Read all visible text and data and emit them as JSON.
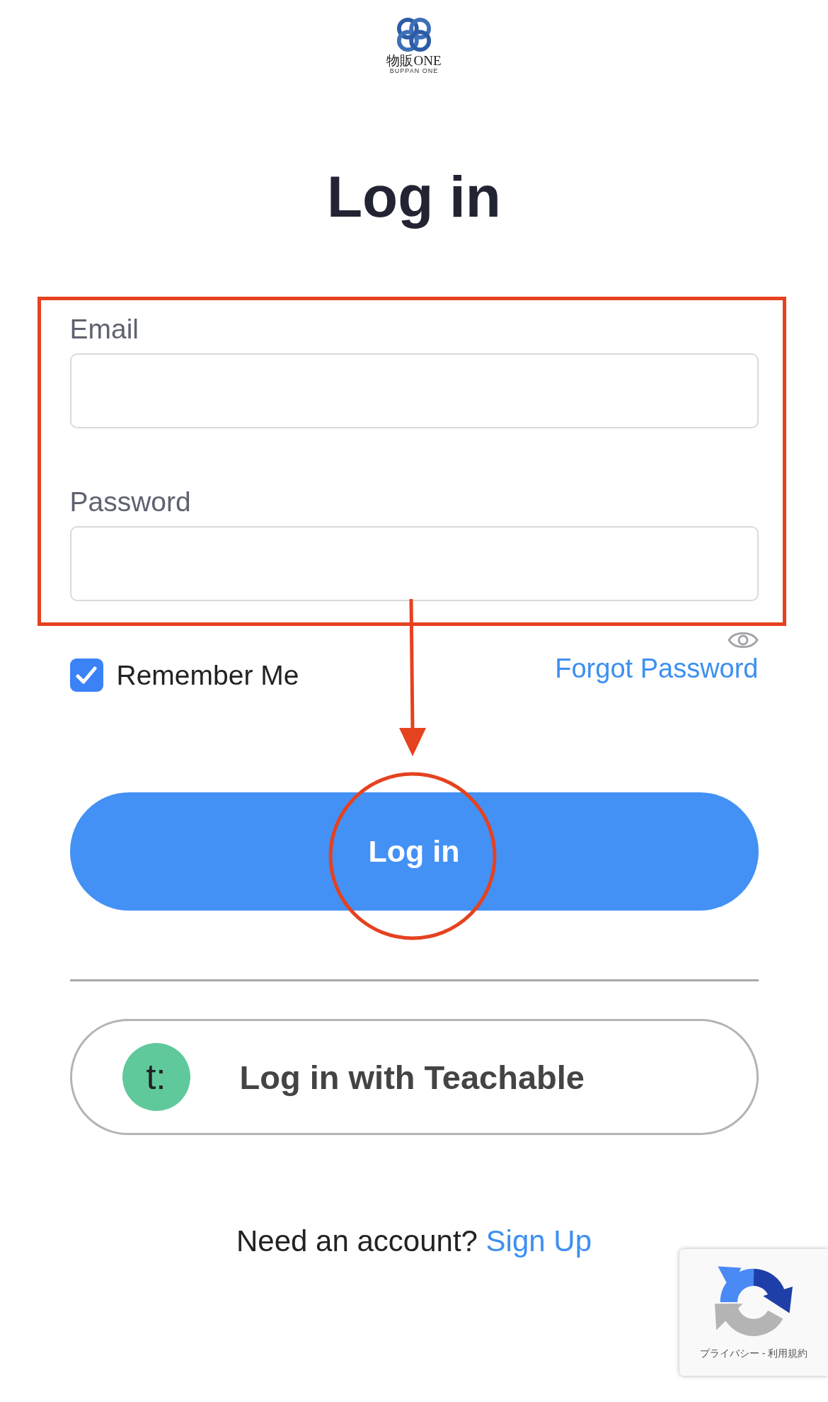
{
  "logo": {
    "wordmark": "物販ONE",
    "tagline": "BUPPAN ONE"
  },
  "title": "Log in",
  "fields": [
    {
      "label": "Email"
    },
    {
      "label": "Password"
    }
  ],
  "remember_me": {
    "label": "Remember Me",
    "checked": true
  },
  "forgot_password": "Forgot Password",
  "login_button": "Log in",
  "teachable_button": {
    "logo_text": "t:",
    "label": "Log in with Teachable"
  },
  "signup": {
    "prompt": "Need an account?",
    "link": "Sign Up"
  },
  "recaptcha": {
    "links": [
      "プライバシー",
      "利用規約"
    ],
    "separator": "-"
  },
  "annotations": [
    {
      "kind": "frame"
    },
    {
      "kind": "arrow"
    },
    {
      "kind": "circle"
    }
  ]
}
